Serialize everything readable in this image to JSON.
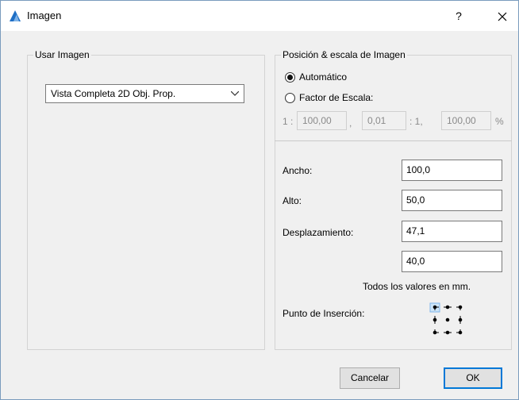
{
  "window": {
    "title": "Imagen",
    "help_label": "?"
  },
  "left_panel": {
    "group_label": "Usar Imagen",
    "select_value": "Vista Completa 2D Obj. Prop."
  },
  "right_panel": {
    "group_label": "Posición & escala de Imagen",
    "radio_auto": "Automático",
    "radio_scale": "Factor de Escala:",
    "scale": {
      "prefix": "1 :",
      "value1": "100,00",
      "sep1": ",",
      "value2": "0,01",
      "sep2": ": 1,",
      "value3": "100,00",
      "suffix": "%"
    },
    "fields": {
      "ancho_label": "Ancho:",
      "ancho_value": "100,0",
      "alto_label": "Alto:",
      "alto_value": "50,0",
      "desp_label": "Desplazamiento:",
      "desp_x_value": "47,1",
      "desp_y_value": "40,0"
    },
    "units_note": "Todos los valores en mm.",
    "insertion_label": "Punto de Inserción:"
  },
  "buttons": {
    "cancel": "Cancelar",
    "ok": "OK"
  },
  "colors": {
    "accent": "#0078d7",
    "icon_blue": "#1f6fc5"
  }
}
